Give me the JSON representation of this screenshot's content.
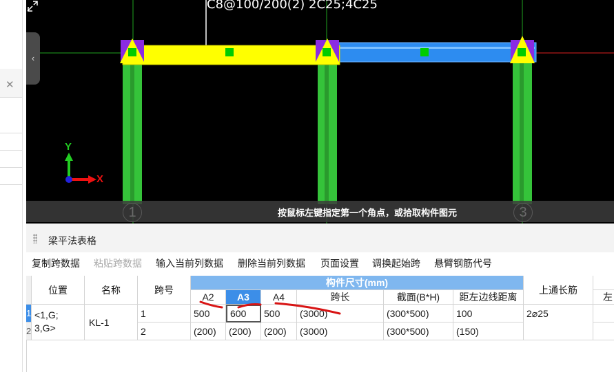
{
  "canvas": {
    "annotation_text": "C8@100/200(2) 2C25;4C25",
    "axis_y": "Y",
    "axis_x": "X",
    "grid_numbers": [
      "1",
      "3"
    ],
    "status_message": "按鼠标左键指定第一个角点，或拾取构件图元",
    "colors": {
      "beam_selected": "#ffff00",
      "beam": "#2d8cf0",
      "column": "#35c33a",
      "marker": "#8a2be2"
    }
  },
  "panel": {
    "title": "梁平法表格",
    "toolbar": [
      {
        "label": "复制跨数据",
        "enabled": true
      },
      {
        "label": "粘贴跨数据",
        "enabled": false
      },
      {
        "label": "输入当前列数据",
        "enabled": true
      },
      {
        "label": "删除当前列数据",
        "enabled": true
      },
      {
        "label": "页面设置",
        "enabled": true
      },
      {
        "label": "调换起始跨",
        "enabled": true
      },
      {
        "label": "悬臂钢筋代号",
        "enabled": true
      }
    ]
  },
  "table": {
    "headers": {
      "position": "位置",
      "name": "名称",
      "span": "跨号",
      "group": "构件尺寸(mm)",
      "a2": "A2",
      "a3": "A3",
      "a4": "A4",
      "span_length": "跨长",
      "section": "截面(B*H)",
      "offset": "距左边线距离",
      "top_rebar": "上通长筋",
      "left": "左"
    },
    "row_numbers": [
      "1",
      "2"
    ],
    "position_value": "<1,G;\n3,G>",
    "position_lines": [
      "<1,G;",
      "3,G>"
    ],
    "name_value": "KL-1",
    "rows": [
      {
        "span": "1",
        "a2": "500",
        "a3": "600",
        "a4": "500",
        "span_length": "(3000)",
        "section": "(300*500)",
        "offset": "100",
        "top_rebar": "2⌀25"
      },
      {
        "span": "2",
        "a2": "(200)",
        "a3": "(200)",
        "a4": "(200)",
        "span_length": "(3000)",
        "section": "(300*500)",
        "offset": "(150)",
        "top_rebar": ""
      }
    ]
  }
}
